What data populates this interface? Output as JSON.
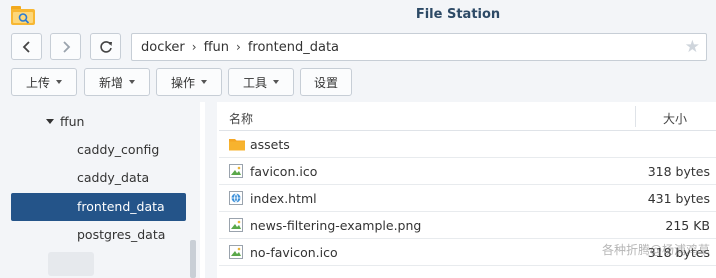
{
  "window": {
    "title": "File Station"
  },
  "nav": {
    "breadcrumb": [
      "docker",
      "ffun",
      "frontend_data"
    ]
  },
  "toolbar": {
    "upload_label": "上传",
    "create_label": "新增",
    "action_label": "操作",
    "tools_label": "工具",
    "settings_label": "设置"
  },
  "tree": {
    "parent": "ffun",
    "items": [
      {
        "label": "caddy_config",
        "selected": false
      },
      {
        "label": "caddy_data",
        "selected": false
      },
      {
        "label": "frontend_data",
        "selected": true
      },
      {
        "label": "postgres_data",
        "selected": false
      }
    ]
  },
  "filelist": {
    "columns": {
      "name": "名称",
      "size": "大小"
    },
    "rows": [
      {
        "name": "assets",
        "size": "",
        "type": "folder-icon"
      },
      {
        "name": "favicon.ico",
        "size": "318 bytes",
        "type": "image-file-icon"
      },
      {
        "name": "index.html",
        "size": "431 bytes",
        "type": "html-file-icon"
      },
      {
        "name": "news-filtering-example.png",
        "size": "215 KB",
        "type": "image-file-icon"
      },
      {
        "name": "no-favicon.ico",
        "size": "318 bytes",
        "type": "image-file-icon"
      }
    ]
  },
  "watermark": "各种折腾@杨浦鸡草",
  "colors": {
    "selected": "#245489",
    "folder": "#f5a623",
    "background": "#f3f5f8"
  }
}
